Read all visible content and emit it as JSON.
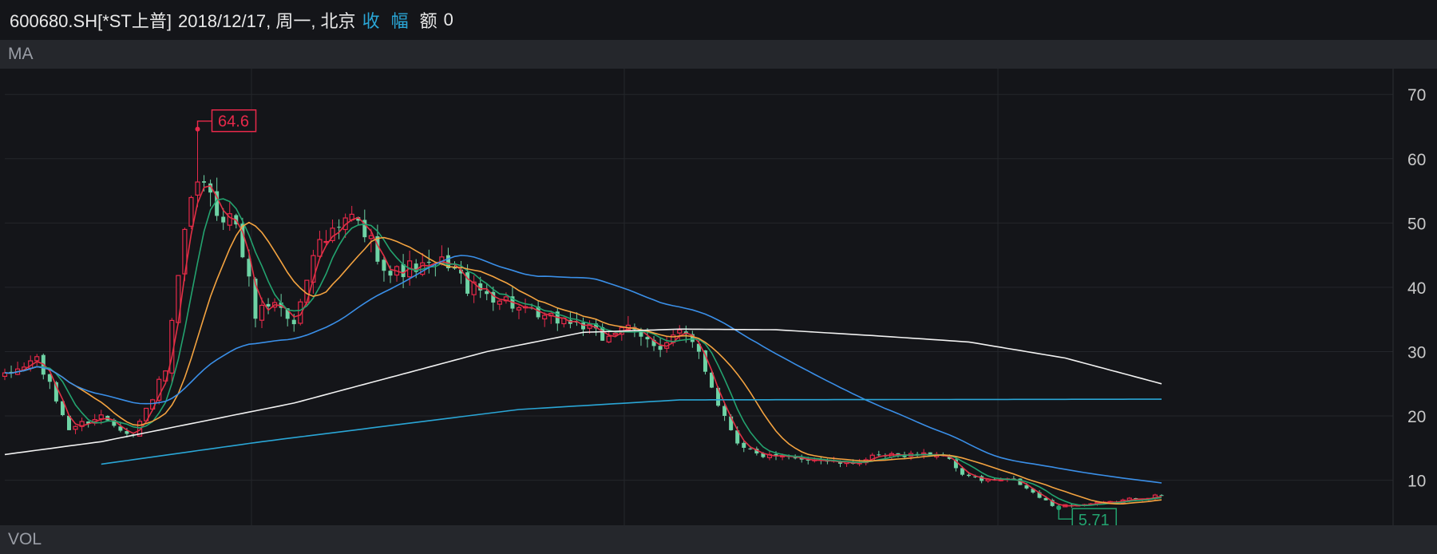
{
  "header": {
    "symbol": "600680.SH[*ST上普]",
    "datetime": "2018/12/17, 周一, 北京",
    "close_label": "收",
    "change_label": "幅",
    "amount_label": "额",
    "amount_value": "0"
  },
  "panels": {
    "ma": "MA",
    "vol": "VOL"
  },
  "colors": {
    "background": "#141519",
    "panel_bar": "#25272c",
    "grid": "#24262b",
    "up": "#e8294a",
    "down": "#6ed3a5",
    "ma_red": "#e23045",
    "ma_green": "#23a36f",
    "ma_orange": "#f4a340",
    "ma_blue": "#3a8fe8",
    "ma_white": "#f2f2f2",
    "ma_cyan": "#2aa6d6",
    "accent": "#2aa6d6"
  },
  "chart_data": {
    "type": "candlestick",
    "y_range": [
      3,
      74
    ],
    "y_ticks": [
      10,
      20,
      30,
      40,
      50,
      60,
      70
    ],
    "grid": true,
    "max_label": "64.6",
    "min_label": "5.71",
    "max_value": 64.6,
    "min_value": 5.71,
    "max_index": 30,
    "min_index": 164,
    "candle_count": 181,
    "close_keypoints": [
      [
        0,
        26
      ],
      [
        5,
        29
      ],
      [
        10,
        18
      ],
      [
        15,
        20
      ],
      [
        20,
        17
      ],
      [
        25,
        27
      ],
      [
        28,
        48
      ],
      [
        30,
        57
      ],
      [
        33,
        52
      ],
      [
        36,
        50
      ],
      [
        39,
        36
      ],
      [
        42,
        38
      ],
      [
        45,
        34
      ],
      [
        48,
        46
      ],
      [
        51,
        48
      ],
      [
        54,
        51
      ],
      [
        57,
        47
      ],
      [
        60,
        42
      ],
      [
        63,
        43
      ],
      [
        66,
        43
      ],
      [
        69,
        44
      ],
      [
        72,
        40
      ],
      [
        75,
        39
      ],
      [
        78,
        38
      ],
      [
        81,
        36
      ],
      [
        84,
        35
      ],
      [
        87,
        35
      ],
      [
        90,
        34
      ],
      [
        93,
        32
      ],
      [
        96,
        34
      ],
      [
        99,
        32
      ],
      [
        102,
        31
      ],
      [
        105,
        33
      ],
      [
        108,
        30
      ],
      [
        111,
        22
      ],
      [
        114,
        16
      ],
      [
        117,
        14
      ],
      [
        120,
        13.5
      ],
      [
        126,
        13.3
      ],
      [
        131,
        12.5
      ],
      [
        135,
        13.5
      ],
      [
        140,
        14
      ],
      [
        146,
        14
      ],
      [
        149,
        11
      ],
      [
        152,
        10
      ],
      [
        157,
        10
      ],
      [
        160,
        8
      ],
      [
        163,
        6
      ],
      [
        168,
        6.2
      ],
      [
        172,
        6.5
      ],
      [
        176,
        7.2
      ],
      [
        180,
        7.6
      ]
    ],
    "ma_series": [
      {
        "color_key": "ma_red",
        "period": 3
      },
      {
        "color_key": "ma_green",
        "period": 6
      },
      {
        "color_key": "ma_orange",
        "period": 12
      },
      {
        "color_key": "ma_blue",
        "period": 45
      }
    ],
    "ma_white_keypoints": [
      [
        0,
        14
      ],
      [
        15,
        16
      ],
      [
        30,
        19
      ],
      [
        45,
        22
      ],
      [
        60,
        26
      ],
      [
        75,
        30
      ],
      [
        90,
        33
      ],
      [
        105,
        33.5
      ],
      [
        120,
        33.4
      ],
      [
        135,
        32.5
      ],
      [
        150,
        31.5
      ],
      [
        165,
        29
      ],
      [
        180,
        25
      ]
    ],
    "ma_cyan_keypoints": [
      [
        15,
        12.5
      ],
      [
        40,
        16
      ],
      [
        60,
        18.5
      ],
      [
        80,
        21
      ],
      [
        105,
        22.5
      ],
      [
        180,
        22.6
      ]
    ]
  }
}
